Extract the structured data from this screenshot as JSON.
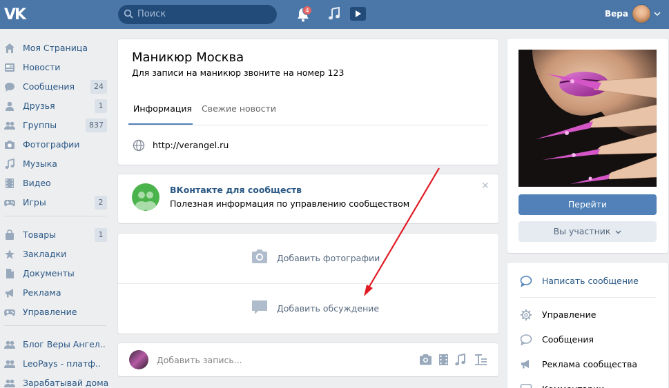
{
  "header": {
    "logo": "VK",
    "search_placeholder": "Поиск",
    "notifications_count": "4",
    "user_name": "Вера"
  },
  "nav": {
    "items": [
      {
        "label": "Моя Страница",
        "icon": "home-icon",
        "count": ""
      },
      {
        "label": "Новости",
        "icon": "news-icon",
        "count": ""
      },
      {
        "label": "Сообщения",
        "icon": "messages-icon",
        "count": "24"
      },
      {
        "label": "Друзья",
        "icon": "friends-icon",
        "count": "1"
      },
      {
        "label": "Группы",
        "icon": "groups-icon",
        "count": "837"
      },
      {
        "label": "Фотографии",
        "icon": "camera-icon",
        "count": ""
      },
      {
        "label": "Музыка",
        "icon": "music-icon",
        "count": ""
      },
      {
        "label": "Видео",
        "icon": "video-icon",
        "count": ""
      },
      {
        "label": "Игры",
        "icon": "gamepad-icon",
        "count": "2"
      },
      {
        "label": "Товары",
        "icon": "bag-icon",
        "count": "1"
      },
      {
        "label": "Закладки",
        "icon": "star-icon",
        "count": ""
      },
      {
        "label": "Документы",
        "icon": "document-icon",
        "count": ""
      },
      {
        "label": "Реклама",
        "icon": "megaphone-icon",
        "count": ""
      },
      {
        "label": "Управление",
        "icon": "gamepad-icon",
        "count": ""
      },
      {
        "label": "Блог Веры Ангел..",
        "icon": "groups-icon",
        "count": ""
      },
      {
        "label": "LeoPays - платф..",
        "icon": "groups-icon",
        "count": ""
      },
      {
        "label": "Зарабатывай дома",
        "icon": "groups-icon",
        "count": ""
      }
    ]
  },
  "group": {
    "title": "Маникюр Москва",
    "status": "Для записи на маникюр звоните на номер 123",
    "tabs": [
      "Информация",
      "Свежие новости"
    ],
    "website": "http://verangel.ru"
  },
  "promo": {
    "title": "ВКонтакте для сообществ",
    "text": "Полезная информация по управлению сообществом",
    "close": "✕"
  },
  "add": {
    "photos": "Добавить фотографии",
    "discussion": "Добавить обсуждение"
  },
  "post": {
    "placeholder": "Добавить запись..."
  },
  "side": {
    "go_button": "Перейти",
    "member_button": "Вы участник",
    "actions": [
      {
        "label": "Написать сообщение",
        "icon": "message-bubble-icon"
      },
      {
        "label": "Управление",
        "icon": "gear-icon"
      },
      {
        "label": "Сообщения",
        "icon": "chat-icon"
      },
      {
        "label": "Реклама сообщества",
        "icon": "megaphone-icon"
      },
      {
        "label": "Комментарии",
        "icon": "comment-icon"
      }
    ]
  },
  "colors": {
    "header": "#4a76a8",
    "link": "#2a5885",
    "button": "#5181b8",
    "arrow": "#e01b24",
    "promo_icon": "#4bb34b"
  }
}
